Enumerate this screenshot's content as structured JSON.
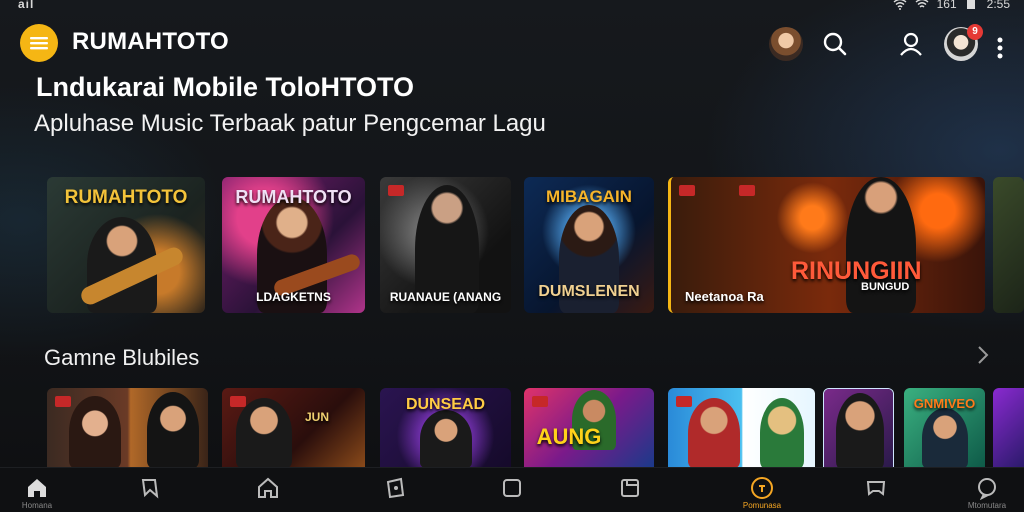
{
  "status_bar": {
    "left": "ail",
    "right_text": "161",
    "time": "2:55"
  },
  "header": {
    "app_title": "RUMAHTOTO",
    "notification_count": "9"
  },
  "hero": {
    "title": "Lndukarai  Mobile TolоHTOTO",
    "subtitle": "Apluhase Music Terbaak patur Pengcemar Lagu"
  },
  "featured": [
    {
      "title": "RUMAHTOTO",
      "caption": ""
    },
    {
      "title": "RUMAHTOTO",
      "caption": "LDAGKETNS"
    },
    {
      "title": "",
      "caption": "RUANAUE (ANANG"
    },
    {
      "title": "MIBAGAIN",
      "caption": "DUMSLENEN"
    },
    {
      "title": "RINUNGIIN",
      "subtitle": "BUNGUD",
      "caption": "Neetanoa  Ra"
    }
  ],
  "section": {
    "title": "Gamne Blubiles"
  },
  "games": [
    {
      "title": ""
    },
    {
      "title": "JUN"
    },
    {
      "title": "DUNSEAD"
    },
    {
      "title": "AUNG"
    },
    {
      "title": ""
    },
    {
      "title": ""
    },
    {
      "title": "GNMIVEO"
    }
  ],
  "bottom_nav": [
    {
      "icon": "home-icon",
      "label": "Homana"
    },
    {
      "icon": "bookmark-icon",
      "label": ""
    },
    {
      "icon": "home-outline-icon",
      "label": ""
    },
    {
      "icon": "tablet-icon",
      "label": ""
    },
    {
      "icon": "square-icon",
      "label": ""
    },
    {
      "icon": "copy-icon",
      "label": ""
    },
    {
      "icon": "target-icon",
      "label": "Pomunasa"
    },
    {
      "icon": "gamepad-icon",
      "label": ""
    },
    {
      "icon": "chat-icon",
      "label": "Mtomutara"
    }
  ],
  "colors": {
    "accent": "#f5b614",
    "active_nav": "#f5a623",
    "background": "#141619"
  }
}
